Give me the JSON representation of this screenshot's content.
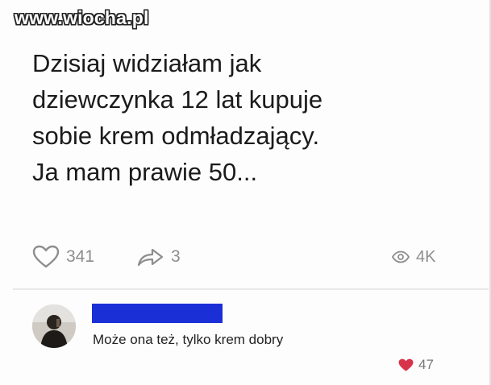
{
  "watermark": "www.wiocha.pl",
  "post": {
    "lines": [
      "Dzisiaj widziałam jak",
      "dziewczynka 12 lat kupuje",
      "sobie krem odmładzający.",
      "Ja mam prawie 50..."
    ]
  },
  "stats": {
    "likes": "341",
    "shares": "3",
    "views": "4K"
  },
  "comment": {
    "text": "Może ona też, tylko krem dobry",
    "likes": "47"
  },
  "colors": {
    "redaction": "#1b2fd6",
    "comment_heart": "#d7334b",
    "stat_gray": "#8e8e8e"
  }
}
